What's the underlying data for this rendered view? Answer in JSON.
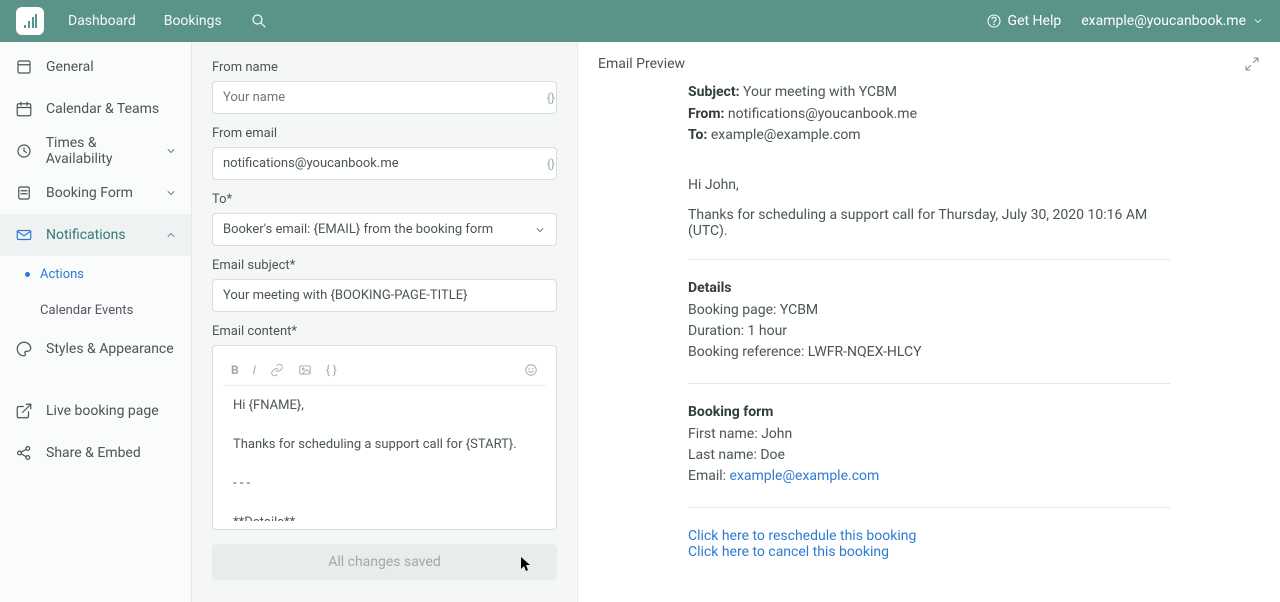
{
  "header": {
    "nav": {
      "dashboard": "Dashboard",
      "bookings": "Bookings"
    },
    "help_label": "Get Help",
    "user_email": "example@youcanbook.me"
  },
  "sidebar": {
    "items": [
      {
        "label": "General"
      },
      {
        "label": "Calendar & Teams"
      },
      {
        "label": "Times & Availability"
      },
      {
        "label": "Booking Form"
      },
      {
        "label": "Notifications"
      },
      {
        "label": "Styles & Appearance"
      },
      {
        "label": "Live booking page"
      },
      {
        "label": "Share & Embed"
      }
    ],
    "notifications_sub": {
      "actions": "Actions",
      "calendar_events": "Calendar Events"
    }
  },
  "form": {
    "from_name": {
      "label": "From name",
      "placeholder": "Your name",
      "value": ""
    },
    "from_email": {
      "label": "From email",
      "value": "notifications@youcanbook.me"
    },
    "to": {
      "label": "To*",
      "value": "Booker's email: {EMAIL} from the booking form"
    },
    "subject": {
      "label": "Email subject*",
      "value": "Your meeting with {BOOKING-PAGE-TITLE}"
    },
    "content": {
      "label": "Email content*",
      "value": "Hi {FNAME},\n\nThanks for scheduling a support call for {START}.\n\n- - -\n\n**Details**\nBooking page: {BOOKING-PAGE-TITLE}\nDuration: {DURATION}"
    },
    "save_label": "All changes saved"
  },
  "preview": {
    "title": "Email Preview",
    "subject_label": "Subject:",
    "subject": "Your meeting with YCBM",
    "from_label": "From:",
    "from": "notifications@youcanbook.me",
    "to_label": "To:",
    "to": "example@example.com",
    "greeting": "Hi John,",
    "intro": "Thanks for scheduling a support call for Thursday, July 30, 2020 10:16 AM (UTC).",
    "details_heading": "Details",
    "details_lines": "Booking page: YCBM\nDuration: 1 hour\nBooking reference: LWFR-NQEX-HLCY",
    "form_heading": "Booking form",
    "form_first": "First name: John",
    "form_last": "Last name: Doe",
    "form_email_label": "Email: ",
    "form_email": "example@example.com",
    "reschedule": "Click here to reschedule this booking",
    "cancel": "Click here to cancel this booking"
  }
}
